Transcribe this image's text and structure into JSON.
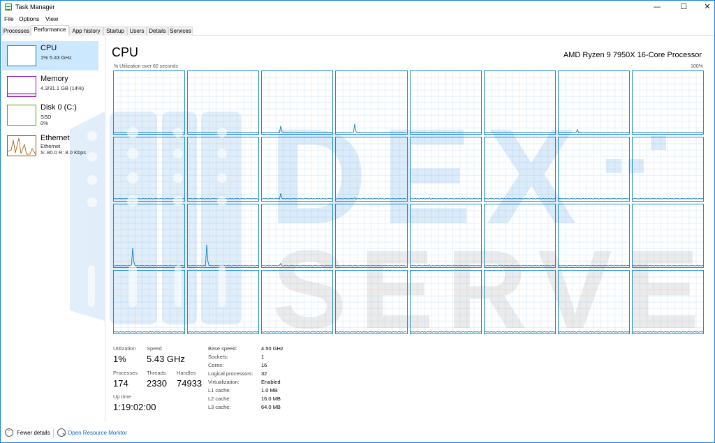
{
  "window": {
    "title": "Task Manager"
  },
  "menu": [
    "File",
    "Options",
    "View"
  ],
  "tabs": [
    {
      "label": "Processes",
      "active": false
    },
    {
      "label": "Performance",
      "active": true
    },
    {
      "label": "App history",
      "active": false
    },
    {
      "label": "Startup",
      "active": false
    },
    {
      "label": "Users",
      "active": false
    },
    {
      "label": "Details",
      "active": false
    },
    {
      "label": "Services",
      "active": false
    }
  ],
  "sidebar": [
    {
      "title": "CPU",
      "lines": [
        "1%  5.43 GHz"
      ],
      "color": "#117dbb"
    },
    {
      "title": "Memory",
      "lines": [
        "4.3/31.1 GB (14%)"
      ],
      "color": "#8b12ae"
    },
    {
      "title": "Disk 0 (C:)",
      "lines": [
        "SSD",
        "0%"
      ],
      "color": "#4da60c"
    },
    {
      "title": "Ethernet",
      "lines": [
        "Ethernet",
        "S: 80.0  R: 8.0 Kbps"
      ],
      "color": "#a74f01"
    }
  ],
  "cpu": {
    "title": "CPU",
    "processor": "AMD Ryzen 9 7950X 16-Core Processor",
    "graph_label_left": "% Utilization over 60 seconds",
    "graph_label_right": "100%",
    "cores_rows": 4,
    "cores_cols": 8,
    "core_spikes": [
      0,
      0,
      0.12,
      0.15,
      0,
      0,
      0.06,
      0,
      0,
      0,
      0.1,
      0.03,
      0.03,
      0,
      0,
      0,
      0.3,
      0.35,
      0.05,
      0,
      0.03,
      0,
      0,
      0,
      0,
      0,
      0,
      0,
      0,
      0,
      0,
      0
    ],
    "line_color": "#117dbb",
    "grid_color": "#d9eaf7"
  },
  "stats": {
    "utilization_label": "Utilization",
    "utilization": "1%",
    "speed_label": "Speed",
    "speed": "5.43 GHz",
    "processes_label": "Processes",
    "processes": "174",
    "threads_label": "Threads",
    "threads": "2330",
    "handles_label": "Handles",
    "handles": "74933",
    "uptime_label": "Up time",
    "uptime": "1:19:02:00"
  },
  "specs": [
    {
      "label": "Base speed:",
      "value": "4.50 GHz"
    },
    {
      "label": "Sockets:",
      "value": "1"
    },
    {
      "label": "Cores:",
      "value": "16"
    },
    {
      "label": "Logical processors:",
      "value": "32"
    },
    {
      "label": "Virtualization:",
      "value": "Enabled"
    },
    {
      "label": "L1 cache:",
      "value": "1.0 MB"
    },
    {
      "label": "L2 cache:",
      "value": "16.0 MB"
    },
    {
      "label": "L3 cache:",
      "value": "64.0 MB"
    }
  ],
  "footer": {
    "fewer_details": "Fewer details",
    "resource_monitor": "Open Resource Monitor"
  },
  "watermark": {
    "line1": "DEX",
    "line2": "SERVER",
    "color1": "#1f7fd8",
    "color2": "#7f7f7f"
  }
}
